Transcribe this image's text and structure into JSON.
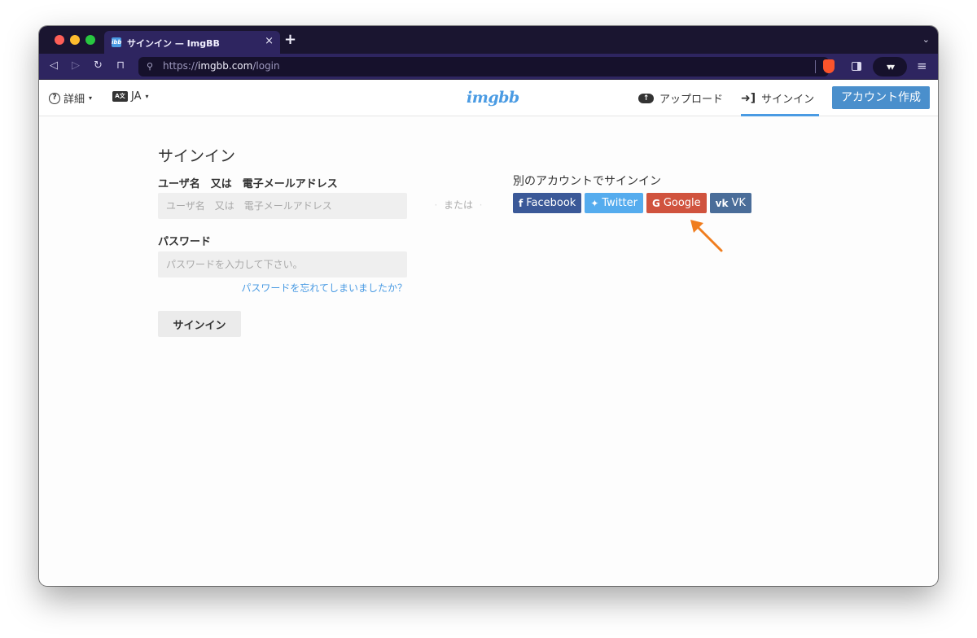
{
  "browser": {
    "tab_title": "サインイン — ImgBB",
    "tab_favicon": "ibb",
    "tab_close": "×",
    "new_tab": "+",
    "tab_menu": "⌄",
    "url_scheme": "https://",
    "url_host": "imgbb.com",
    "url_path": "/login",
    "profile_glyph": "▾▾"
  },
  "header": {
    "help_icon_glyph": "?",
    "help_label": "詳細",
    "lang_icon_glyph": "A文",
    "lang_label": "JA",
    "caret": "▾",
    "logo": "imgbb",
    "upload_label": "アップロード",
    "signin_label": "サインイン",
    "signup_label": "アカウント作成"
  },
  "form": {
    "title": "サインイン",
    "username_label": "ユーザ名　又は　電子メールアドレス",
    "username_placeholder": "ユーザ名　又は　電子メールアドレス",
    "password_label": "パスワード",
    "password_placeholder": "パスワードを入力して下さい。",
    "forgot_link": "パスワードを忘れてしまいましたか？",
    "submit_label": "サインイン"
  },
  "separator": {
    "label": "または"
  },
  "social": {
    "title": "別のアカウントでサインイン",
    "buttons": [
      {
        "label": "Facebook",
        "icon": "facebook-icon",
        "glyph": "f",
        "color": "#3b5998"
      },
      {
        "label": "Twitter",
        "icon": "twitter-icon",
        "glyph": "✦",
        "color": "#55acee"
      },
      {
        "label": "Google",
        "icon": "google-icon",
        "glyph": "G",
        "color": "#d0533e"
      },
      {
        "label": "VK",
        "icon": "vk-icon",
        "glyph": "vk",
        "color": "#4a6d99"
      }
    ]
  },
  "colors": {
    "accent": "#4a9be3",
    "annotation_arrow": "#f07d1e"
  }
}
